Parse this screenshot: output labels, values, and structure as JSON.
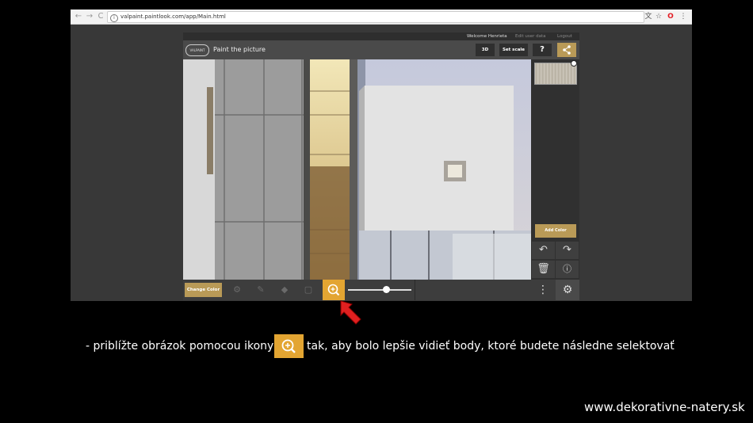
{
  "browser": {
    "url": "valpaint.paintlook.com/app/Main.html",
    "nav": {
      "back": "←",
      "forward": "→",
      "reload": "C"
    },
    "toolbar_icons": [
      "translate-icon",
      "star-icon",
      "opera-icon",
      "menu-icon"
    ]
  },
  "app": {
    "userbar": {
      "welcome": "Welcome Henrieta",
      "edit": "Edit user data",
      "logout": "Logout"
    },
    "logo_text": "VALPAINT",
    "title": "Paint the picture",
    "buttons": {
      "three_d": "3D",
      "set_scale": "Set scale",
      "help": "?"
    },
    "add_color": "Add Color",
    "change_color": "Change Color",
    "zoom_level": 0.6
  },
  "instruction": {
    "before": "- priblížte obrázok pomocou ikony",
    "after": "tak, aby bolo lepšie vidieť body, ktoré budete následne selektovať"
  },
  "footer": "www.dekorativne-natery.sk",
  "colors": {
    "accent": "#e3a532",
    "gold": "#b99a57",
    "dark": "#3b3b3b",
    "arrow": "#e02020"
  }
}
